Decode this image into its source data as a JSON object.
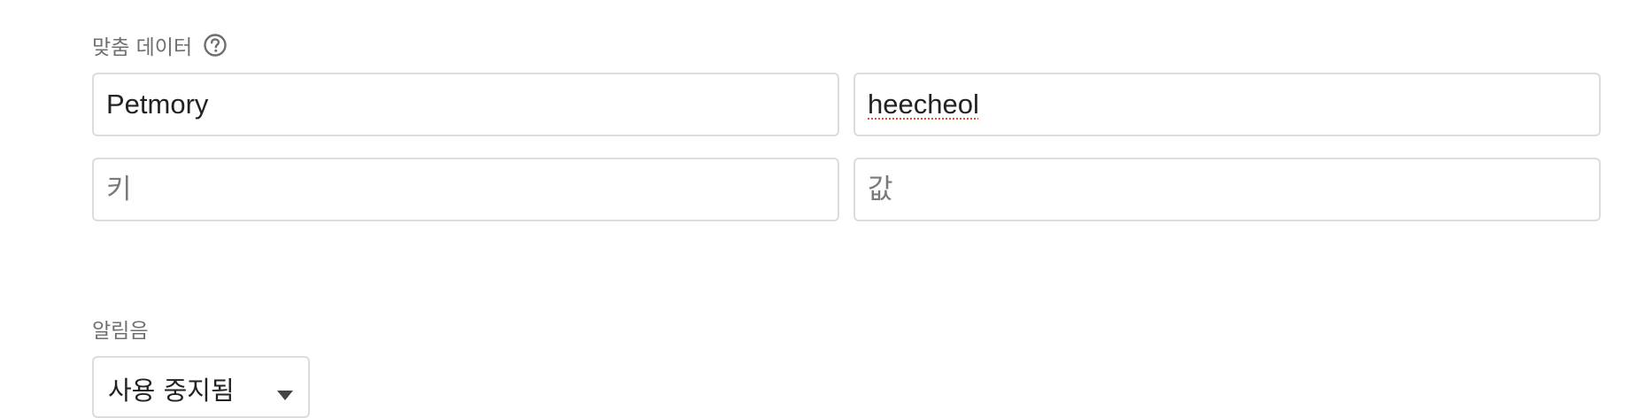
{
  "custom_data": {
    "label": "맞춤 데이터",
    "rows": [
      {
        "key_value": "Petmory",
        "key_placeholder": "키",
        "value_value": "heecheol",
        "value_placeholder": "값"
      },
      {
        "key_value": "",
        "key_placeholder": "키",
        "value_value": "",
        "value_placeholder": "값"
      }
    ]
  },
  "notification_sound": {
    "label": "알림음",
    "selected": "사용 중지됨"
  },
  "icons": {
    "help": "help-circle-icon",
    "dropdown": "dropdown-arrow-icon"
  },
  "colors": {
    "label_text": "#6f6f6f",
    "border": "#dcdcdc",
    "spellcheck_underline": "#e0513c"
  }
}
